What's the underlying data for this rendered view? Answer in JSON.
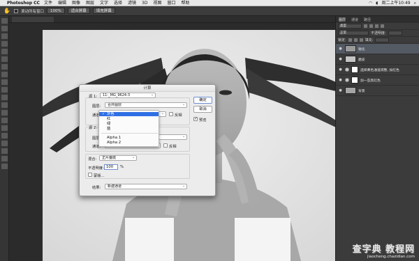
{
  "menubar": {
    "app": "Photoshop CC",
    "items": [
      "文件",
      "编辑",
      "图像",
      "图层",
      "文字",
      "选择",
      "滤镜",
      "3D",
      "视图",
      "窗口",
      "帮助"
    ],
    "clock": "周二上午10:49"
  },
  "options": {
    "checkbox_label": "滚动所有窗口",
    "zoom": "100%",
    "btn_fit": "适合屏幕",
    "btn_fill": "填充屏幕"
  },
  "panel": {
    "tabs": [
      "图层",
      "通道",
      "路径"
    ],
    "search_label": "类型",
    "blend_mode": "正常",
    "opacity_label": "不透明度:",
    "lock_label": "锁定:",
    "fill_label": "填充:",
    "layers": [
      {
        "name": "锐化",
        "selected": true
      },
      {
        "name": "磨皮",
        "selected": false
      },
      {
        "name": "选择黄色通道调整, 加红色",
        "selected": false
      },
      {
        "name": "加一些高红色",
        "selected": false
      },
      {
        "name": "背景",
        "selected": false
      }
    ]
  },
  "dialog": {
    "title": "计算",
    "source1_label": "源 1:",
    "source1_value": "11-_MG_9624-3",
    "layer1_label": "图层:",
    "layer1_value": "合并图层",
    "channel1_label": "通道:",
    "invert1_label": "反相",
    "source2_label": "源 2:",
    "layer2_label": "图层:",
    "channel2_label": "通道:",
    "invert2_label": "反相",
    "blend_label": "混合:",
    "blend_value": "正片叠底",
    "opacity_label": "不透明度:",
    "opacity_value": "100",
    "opacity_unit": "%",
    "mask_label": "蒙版...",
    "result_label": "结果:",
    "result_value": "新建通道",
    "ok_label": "确定",
    "cancel_label": "取消",
    "preview_label": "预览",
    "preview_checked": true
  },
  "channel_popup": {
    "options": [
      "灰色",
      "红",
      "绿",
      "蓝",
      "Alpha 1",
      "Alpha 2"
    ],
    "selected": "灰色"
  },
  "watermark": {
    "brand": "查字典 教程网",
    "url": "jiaocheng.chazidian.com"
  }
}
